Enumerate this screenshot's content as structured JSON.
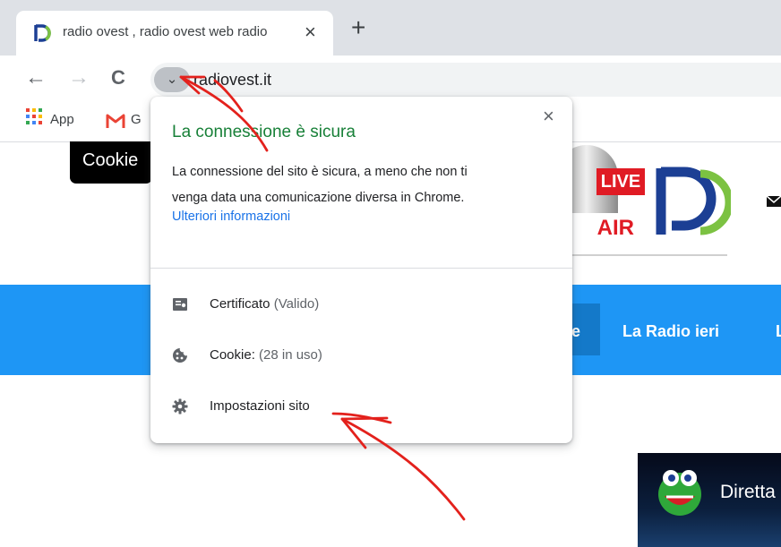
{
  "tab": {
    "title": "radio ovest , radio ovest web radio",
    "close": "×"
  },
  "toolbar": {
    "back": "←",
    "forward": "→",
    "reload": "C",
    "chip_icon": "chevron-down-icon",
    "chip_glyph": "⌄",
    "url": "radiovest.it"
  },
  "bookmarks": {
    "apps": "App",
    "gmail_initial": "G"
  },
  "site": {
    "cookie_tab": "Cookie",
    "live_badge": "LIVE",
    "air_badge": "AIR",
    "nav_links": [
      "e",
      "La Radio ieri",
      "L"
    ],
    "video_title": "Diretta"
  },
  "popup": {
    "close": "×",
    "heading": "La connessione è sicura",
    "body_line1": "La connessione del sito è sicura, a meno che non ti",
    "body_line2": "venga data una comunicazione diversa in Chrome.",
    "link": "Ulteriori informazioni",
    "items": [
      {
        "label": "Certificato",
        "suffix": " (Valido)",
        "icon": "certificate-icon"
      },
      {
        "label": "Cookie:",
        "suffix": " (28 in uso)",
        "icon": "cookie-icon"
      },
      {
        "label": "Impostazioni sito",
        "suffix": "",
        "icon": "gear-icon"
      }
    ]
  },
  "colors": {
    "secure_green": "#188038",
    "link_blue": "#1a73e8",
    "navbar_blue": "#1e96f5",
    "annotation_red": "#e3211c"
  }
}
